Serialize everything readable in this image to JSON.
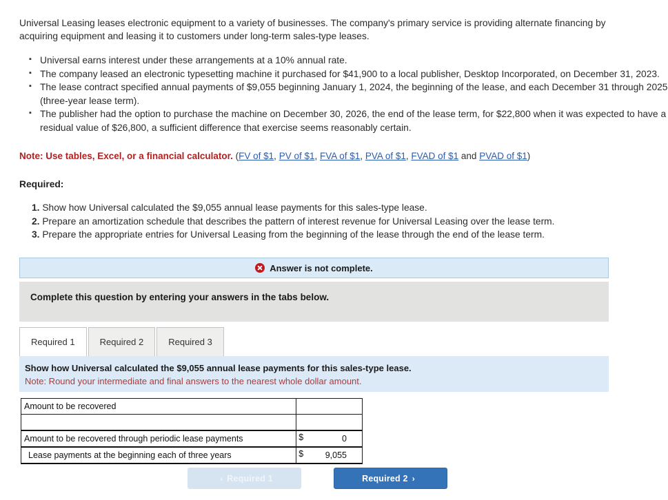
{
  "intro": "Universal Leasing leases electronic equipment to a variety of businesses. The company's primary service is providing alternate financing by acquiring equipment and leasing it to customers under long-term sales-type leases.",
  "facts": [
    "Universal earns interest under these arrangements at a 10% annual rate.",
    "The company leased an electronic typesetting machine it purchased for $41,900 to a local publisher, Desktop Incorporated, on December 31, 2023.",
    "The lease contract specified annual payments of $9,055 beginning January 1, 2024, the beginning of the lease, and each December 31 through 2025 (three-year lease term).",
    "The publisher had the option to purchase the machine on December 30, 2026, the end of the lease term, for $22,800 when it was expected to have a residual value of $26,800, a sufficient difference that exercise seems reasonably certain."
  ],
  "note": {
    "bold_text": "Note: Use tables, Excel, or a financial calculator.",
    "open_paren": "(",
    "links": [
      {
        "label": "FV of $1",
        "sep": ", "
      },
      {
        "label": "PV of $1",
        "sep": ", "
      },
      {
        "label": "FVA of $1",
        "sep": ", "
      },
      {
        "label": "PVA of $1",
        "sep": ", "
      },
      {
        "label": "FVAD of $1",
        "sep": " and "
      },
      {
        "label": "PVAD of $1",
        "sep": ""
      }
    ],
    "close_paren": ")"
  },
  "required": {
    "heading": "Required:",
    "items": [
      {
        "num": "1.",
        "text": "Show how Universal calculated the $9,055 annual lease payments for this sales-type lease."
      },
      {
        "num": "2.",
        "text": "Prepare an amortization schedule that describes the pattern of interest revenue for Universal Leasing over the lease term."
      },
      {
        "num": "3.",
        "text": "Prepare the appropriate entries for Universal Leasing from the beginning of the lease through the end of the lease term."
      }
    ]
  },
  "status_banner": {
    "icon": "error-circle-x-icon",
    "text": "Answer is not complete.",
    "background_color": "#daeaf6",
    "icon_color": "#c2181f"
  },
  "grey_strip": {
    "text": "Complete this question by entering your answers in the tabs below.",
    "background_color": "#e2e2e0"
  },
  "tabs": [
    {
      "label": "Required 1",
      "active": true
    },
    {
      "label": "Required 2",
      "active": false
    },
    {
      "label": "Required 3",
      "active": false
    }
  ],
  "blue_panel": {
    "line1": "Show how Universal calculated the $9,055 annual lease payments for this sales-type lease.",
    "line2": "Note: Round your intermediate and final answers to the nearest whole dollar amount.",
    "background_color": "#dbeaf6",
    "line2_color": "#b03a3a"
  },
  "answer_table": {
    "rows": [
      {
        "label": "Amount to be recovered",
        "currency": "",
        "value": "",
        "indent": false
      },
      {
        "label": "",
        "currency": "",
        "value": "",
        "indent": false
      },
      {
        "label": "Amount to be recovered through periodic lease payments",
        "currency": "$",
        "value": "0",
        "indent": false
      },
      {
        "label": "Lease payments at the beginning each of three years",
        "currency": "$",
        "value": "9,055",
        "indent": true
      }
    ]
  },
  "nav": {
    "prev": {
      "label": "Required 1",
      "chevron": "‹",
      "disabled": true
    },
    "next": {
      "label": "Required 2",
      "chevron": "›",
      "disabled": false
    },
    "accent_color": "#3573b9"
  }
}
